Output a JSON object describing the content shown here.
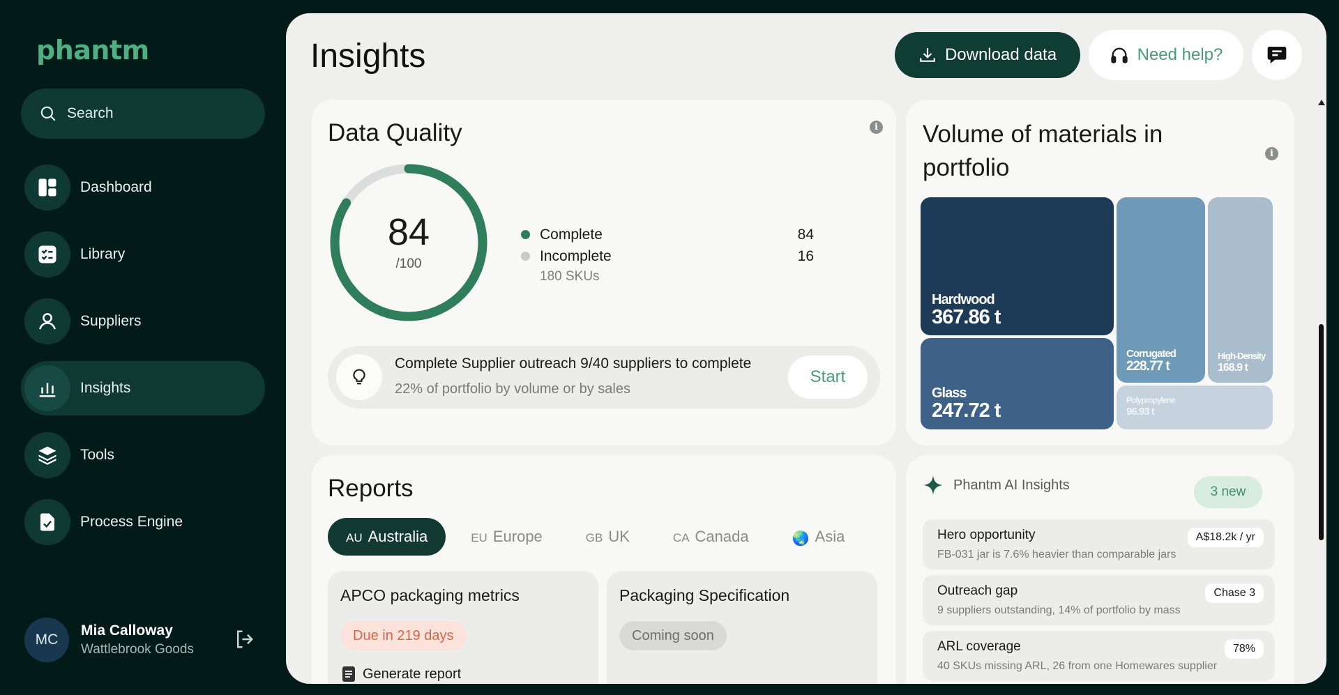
{
  "app": {
    "logo": "phantm"
  },
  "sidebar": {
    "search_label": "Search",
    "items": [
      {
        "label": "Dashboard",
        "icon": "dashboard-icon"
      },
      {
        "label": "Library",
        "icon": "checklist-icon"
      },
      {
        "label": "Suppliers",
        "icon": "person-icon"
      },
      {
        "label": "Insights",
        "icon": "bar-chart-icon",
        "active": true
      },
      {
        "label": "Tools",
        "icon": "layers-icon"
      },
      {
        "label": "Process Engine",
        "icon": "file-check-icon"
      }
    ],
    "user": {
      "initials": "MC",
      "name": "Mia Calloway",
      "org": "Wattlebrook Goods"
    }
  },
  "header": {
    "title": "Insights",
    "download_label": "Download data",
    "help_label": "Need help?"
  },
  "data_quality": {
    "title": "Data Quality",
    "score": "84",
    "score_denominator": "/100",
    "complete_fraction": 0.84,
    "legend": [
      {
        "label": "Complete",
        "value": "84",
        "color": "#2e7d5b"
      },
      {
        "label": "Incomplete",
        "value": "16",
        "color": "#c9cbca"
      }
    ],
    "sku_count": "180 SKUs",
    "outreach": {
      "title": "Complete Supplier outreach 9/40 suppliers to complete",
      "subtitle": "22% of portfolio by volume or by sales",
      "button": "Start"
    }
  },
  "volume": {
    "title": "Volume of materials in portfolio",
    "materials": [
      {
        "name": "Hardwood",
        "value": "367.86 t",
        "color": "#1d3a57"
      },
      {
        "name": "Glass",
        "value": "247.72 t",
        "color": "#3e6287"
      },
      {
        "name": "Corrugated",
        "value": "228.77 t",
        "color": "#6f9ab8"
      },
      {
        "name": "High-Density",
        "value": "168.9 t",
        "color": "#a9bdcd"
      },
      {
        "name": "Polypropylene",
        "value": "96.93 t",
        "color": "#c6d3de"
      }
    ]
  },
  "reports": {
    "title": "Reports",
    "tabs": [
      {
        "code": "AU",
        "label": "Australia",
        "active": true
      },
      {
        "code": "EU",
        "label": "Europe"
      },
      {
        "code": "GB",
        "label": "UK"
      },
      {
        "code": "CA",
        "label": "Canada"
      },
      {
        "code": "🌏",
        "label": "Asia"
      }
    ],
    "cards": [
      {
        "title": "APCO packaging metrics",
        "status": "Due in 219 days",
        "action": "Generate report"
      },
      {
        "title": "Packaging Specification",
        "status": "Coming soon"
      }
    ]
  },
  "ai_insights": {
    "title": "Phantm AI Insights",
    "badge": "3 new",
    "items": [
      {
        "title": "Hero opportunity",
        "subtitle": "FB-031 jar is 7.6% heavier than comparable jars",
        "badge": "A$18.2k / yr"
      },
      {
        "title": "Outreach gap",
        "subtitle": "9 suppliers outstanding, 14% of portfolio by mass",
        "badge": "Chase 3"
      },
      {
        "title": "ARL coverage",
        "subtitle": "40 SKUs missing ARL, 26 from one Homewares supplier",
        "badge": "78%"
      }
    ]
  }
}
